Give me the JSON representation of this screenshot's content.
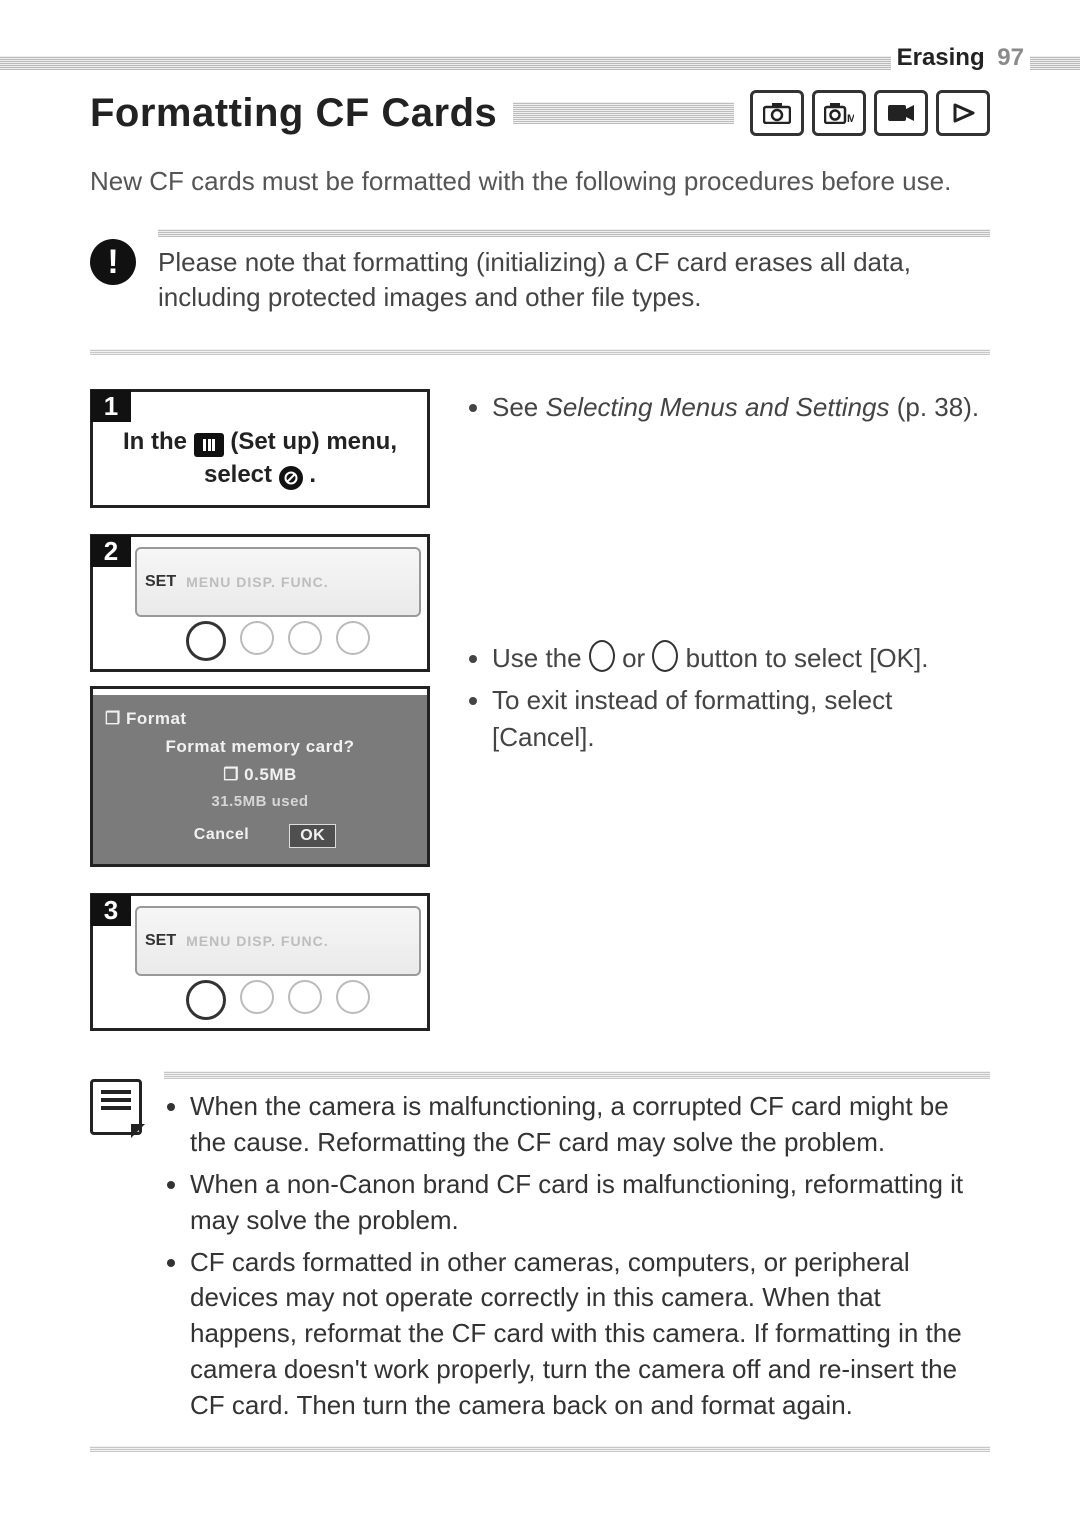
{
  "header": {
    "section": "Erasing",
    "page_number": "97"
  },
  "title": "Formatting CF Cards",
  "mode_icons": [
    "camera-icon",
    "camera-m-icon",
    "movie-icon",
    "play-icon"
  ],
  "intro": "New CF cards must be formatted with the following procedures before use.",
  "caution": "Please note that formatting (initializing) a CF card erases all data, including protected images and other file types.",
  "step1": {
    "number": "1",
    "line1_a": "In the ",
    "line1_b": " (Set up) menu,",
    "line2_a": "select ",
    "line2_b": "."
  },
  "step1_desc_prefix": "See ",
  "step1_desc_italic": "Selecting Menus and Settings",
  "step1_desc_suffix": " (p. 38).",
  "step2": {
    "number": "2",
    "dial_set": "SET",
    "dial_labels": "MENU  DISP.  FUNC.",
    "lcd_title": "❐ Format",
    "lcd_q": "Format memory card?",
    "lcd_size": "❐ 0.5MB",
    "lcd_used": "31.5MB used",
    "lcd_cancel": "Cancel",
    "lcd_ok": "OK"
  },
  "step2_desc": {
    "item1_a": "Use the ",
    "item1_b": " or ",
    "item1_c": " button to select [OK].",
    "item2": "To exit instead of formatting, select [Cancel]."
  },
  "step3": {
    "number": "3",
    "dial_set": "SET",
    "dial_labels": "MENU  DISP.  FUNC."
  },
  "notes": {
    "n1": "When the camera is malfunctioning, a corrupted CF card might be the cause. Reformatting the CF card may solve the problem.",
    "n2": "When a non-Canon brand CF card is malfunctioning, reformatting it may solve the problem.",
    "n3": "CF cards formatted in other cameras, computers, or peripheral devices may not operate correctly in this camera. When that happens, reformat the CF card with this camera. If formatting in the camera doesn't work properly, turn the camera off and re-insert the CF card. Then turn the camera back on and format again."
  }
}
